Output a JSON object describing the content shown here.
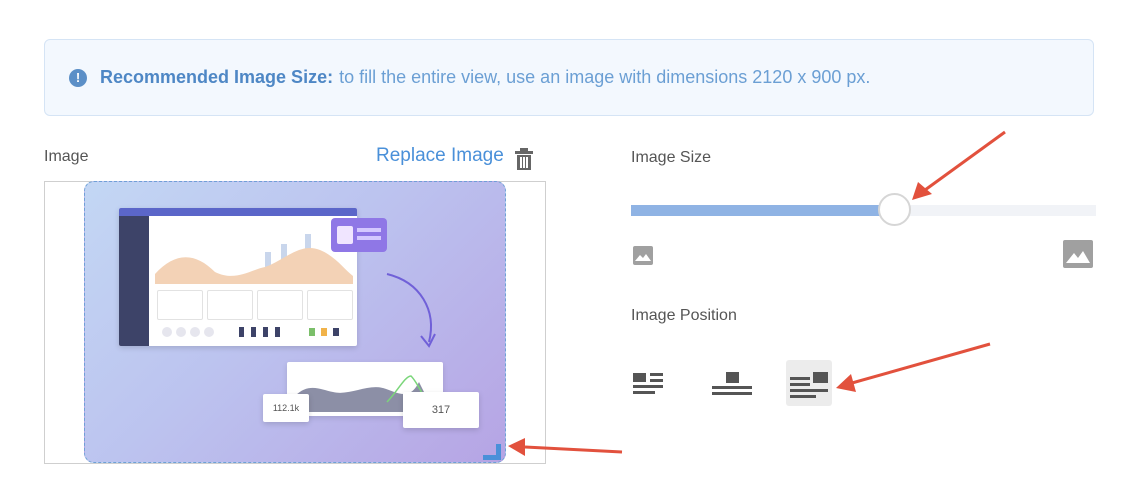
{
  "banner": {
    "icon": "info-icon",
    "icon_glyph": "!",
    "title": "Recommended Image Size:",
    "text": "to fill the entire view, use an image with dimensions 2120 x 900 px."
  },
  "image_panel": {
    "label": "Image",
    "replace_label": "Replace Image",
    "delete_icon": "trash-icon"
  },
  "preview": {
    "card_left_value": "112.1k",
    "card_right_value": "317"
  },
  "image_size": {
    "label": "Image Size",
    "value_fraction": 0.565,
    "min_icon": "image-small-icon",
    "max_icon": "image-large-icon"
  },
  "image_position": {
    "label": "Image Position",
    "options": [
      {
        "name": "image-left",
        "icon": "align-left-icon",
        "active": false
      },
      {
        "name": "image-center",
        "icon": "align-center-icon",
        "active": false
      },
      {
        "name": "image-right",
        "icon": "align-right-icon",
        "active": true
      }
    ]
  },
  "colors": {
    "accent": "#4a90d9",
    "banner_text": "#6b9fd4",
    "slider_fill": "#8fb3e4",
    "annotation_arrow": "#e2513d"
  }
}
